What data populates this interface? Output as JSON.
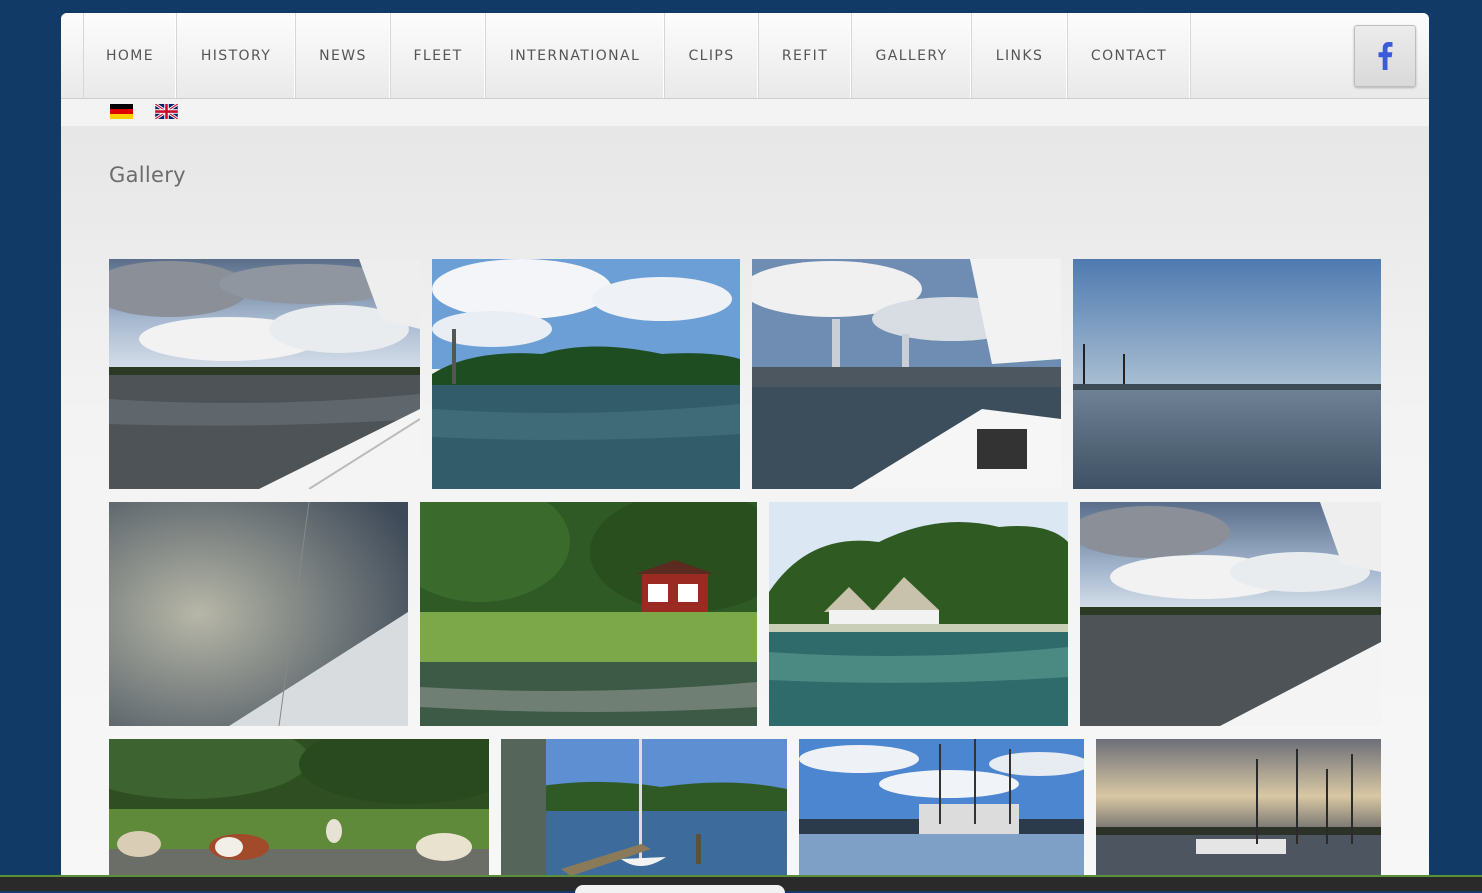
{
  "nav": {
    "items": [
      "HOME",
      "HISTORY",
      "NEWS",
      "FLEET",
      "INTERNATIONAL",
      "CLIPS",
      "REFIT",
      "GALLERY",
      "LINKS",
      "CONTACT"
    ],
    "social_icon": "facebook-icon"
  },
  "languages": [
    "german-flag-icon",
    "english-flag-icon"
  ],
  "page": {
    "title": "Gallery"
  },
  "gallery": {
    "photos": [
      "sailing-cloudy-sky",
      "island-with-trees",
      "bridge-with-sail",
      "foggy-harbor-reflection",
      "fog-bank-sailing",
      "red-hut-reeds",
      "thatched-houses-shore",
      "sailing-cloudy-sky-2",
      "cows-by-water",
      "harbor-pier-sailboat",
      "marina-masts",
      "sunset-marina"
    ]
  },
  "colors": {
    "background": "#123a66",
    "facebook": "#3b5bd8",
    "text": "#555555"
  }
}
